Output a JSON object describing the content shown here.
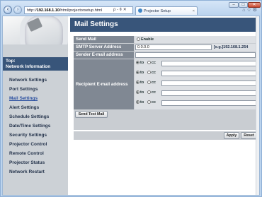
{
  "browser": {
    "address_prefix": "http://",
    "address_host": "192.168.1.10",
    "address_path": "/html/projectorsetup.html",
    "address_tools": "ρ - ¢ ✕",
    "tab_title": "Projector Setup",
    "tab_close": "×",
    "back_glyph": "‹",
    "forward_glyph": "›",
    "window_controls": [
      "–",
      "□",
      "✕"
    ],
    "right_tools": "⌂☆⚙"
  },
  "sidebar": {
    "top_label": "Top:",
    "top_title": "Network Information",
    "items": [
      {
        "label": "Network Settings"
      },
      {
        "label": "Port Settings"
      },
      {
        "label": "Mail Settings"
      },
      {
        "label": "Alert Settings"
      },
      {
        "label": "Schedule Settings"
      },
      {
        "label": "Date/Time Settings"
      },
      {
        "label": "Security Settings"
      },
      {
        "label": "Projector Control"
      },
      {
        "label": "Remote Control"
      },
      {
        "label": "Projector Status"
      },
      {
        "label": "Network Restart"
      }
    ],
    "active_index": 2
  },
  "main": {
    "title": "Mail Settings",
    "send_mail": {
      "label": "Send Mail",
      "option": "Enable",
      "checked": false
    },
    "smtp": {
      "label": "SMTP Server Address",
      "value": "0.0.0.0",
      "hint": "[e.g.]192.168.1.254"
    },
    "sender": {
      "label": "Sender E-mail address",
      "value": ""
    },
    "recipient": {
      "label": "Recipient E-mail address",
      "to_label": "to",
      "cc_label": "cc",
      "rows": [
        {
          "to_selected": true,
          "value": ""
        },
        {
          "to_selected": true,
          "value": ""
        },
        {
          "to_selected": true,
          "value": ""
        },
        {
          "to_selected": true,
          "value": ""
        },
        {
          "to_selected": true,
          "value": ""
        }
      ]
    },
    "send_test_label": "Send Test Mail",
    "apply_label": "Apply",
    "reset_label": "Reset"
  }
}
